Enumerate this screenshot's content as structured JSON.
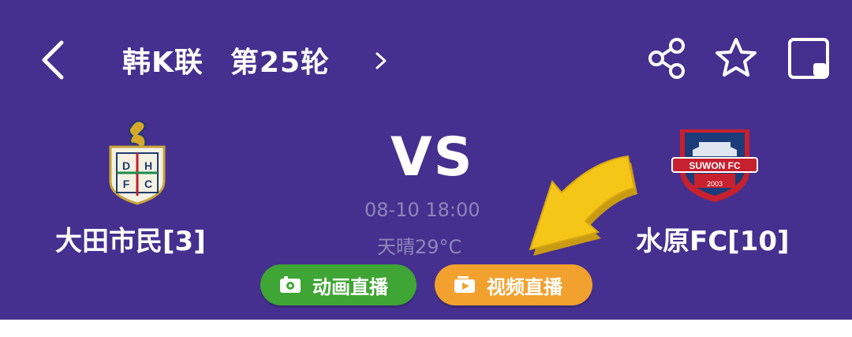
{
  "header": {
    "title_league": "韩K联",
    "title_round": "第25轮",
    "back_icon": "chevron-left-icon",
    "title_chevron_icon": "chevron-right-icon",
    "actions": [
      "share-icon",
      "star-icon",
      "minimize-window-icon"
    ]
  },
  "match": {
    "home": {
      "name": "大田市民[3]",
      "logo_letters": "DHFC"
    },
    "away": {
      "name": "水原FC[10]",
      "logo_text": "SUWON FC",
      "logo_year": "2003"
    },
    "vs": "VS",
    "datetime": "08-10 18:00",
    "weather": "天晴29°C"
  },
  "buttons": {
    "animation_live": "动画直播",
    "video_live": "视频直播"
  },
  "colors": {
    "header_bg": "#45308f",
    "muted_text": "#8f86b9",
    "animation_button": "#3fa534",
    "video_button": "#f2a12e",
    "annotation_arrow": "#f5c518"
  }
}
